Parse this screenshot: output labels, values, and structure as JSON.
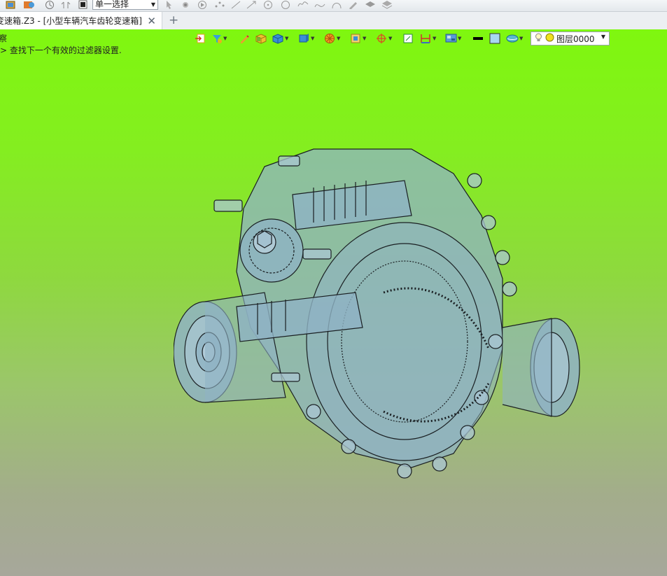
{
  "toolbar": {
    "select_mode": "单一选择"
  },
  "tabs": {
    "active_label": "变速箱.Z3 - [小型车辆汽车齿轮变速箱]",
    "close_symbol": "✕",
    "add_symbol": "+"
  },
  "viewport": {
    "message_line1": "察",
    "message_line2": "> 查找下一个有效的过滤器设置.",
    "layer_label": "图层0000",
    "background_top": "#7ff70f",
    "background_bottom": "#a7a79b",
    "model_color": "#8fb3c4"
  },
  "icons": {
    "top": [
      "window-icon",
      "palette-icon",
      "history-icon",
      "undo-icon",
      "stop-icon",
      "pick-icon",
      "snap-icon",
      "play-icon",
      "points-icon",
      "line-icon",
      "arrow-line-icon",
      "circle-point-icon",
      "circle-icon",
      "spline-icon",
      "curve-icon",
      "arc-icon",
      "pen-icon",
      "layer-stack-icon",
      "stack-icon"
    ],
    "viewport": [
      "import-icon",
      "filter-icon",
      "pencil-icon",
      "cube-yellow-icon",
      "cube-blue-icon",
      "view-cube-icon",
      "render-sphere-icon",
      "face-select-icon",
      "target-icon",
      "fit-icon",
      "dimension-icon",
      "display-mode-icon",
      "line-color-icon",
      "fill-color-icon",
      "material-icon",
      "bulb-icon",
      "layer-circle-icon"
    ]
  }
}
